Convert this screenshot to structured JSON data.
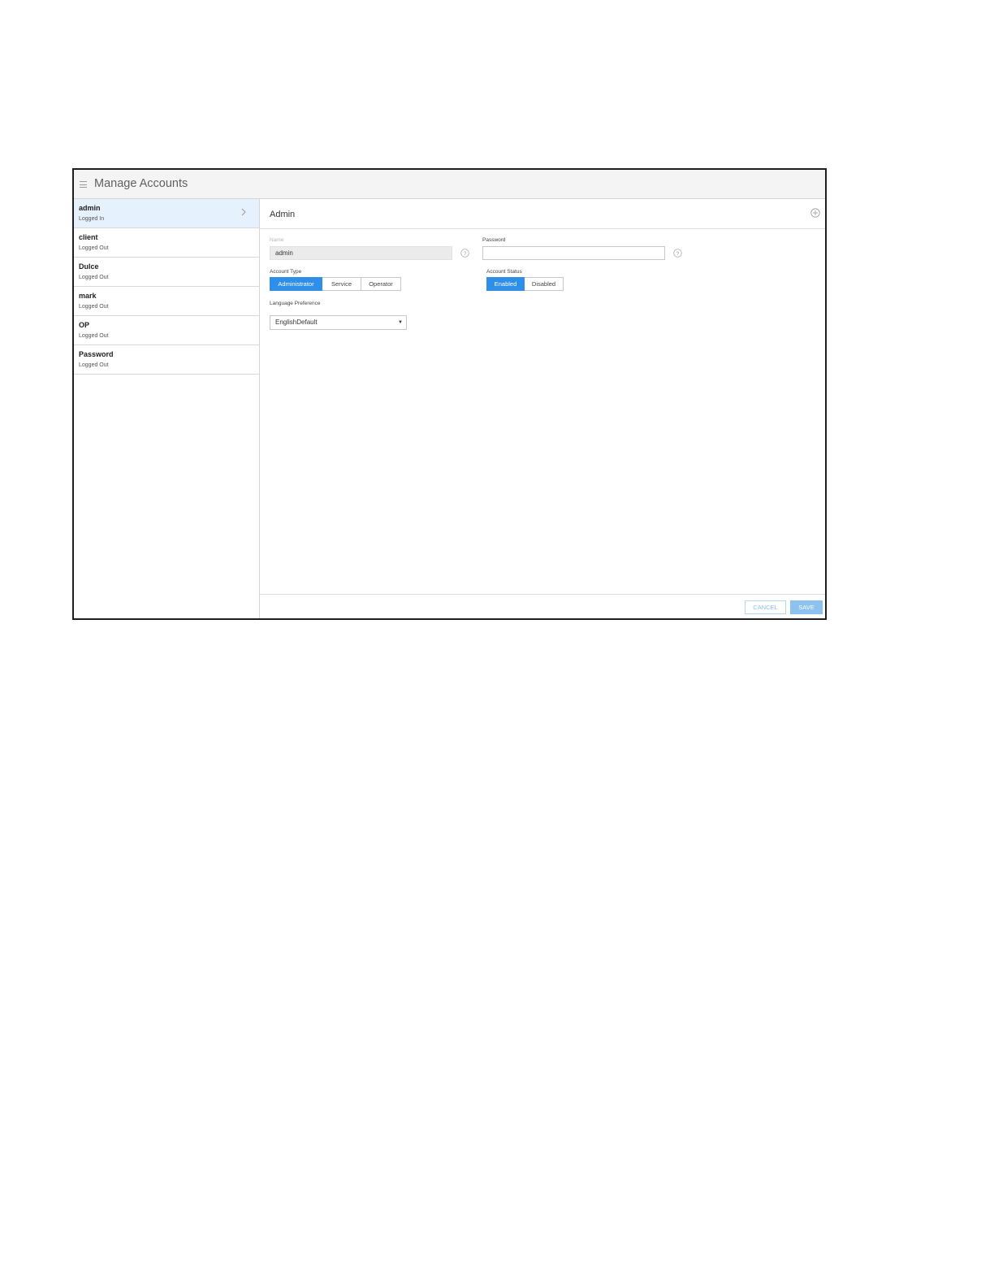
{
  "app": {
    "title": "Manage Accounts",
    "menu_icon": "hamburger-icon"
  },
  "accounts": [
    {
      "name": "admin",
      "status": "Logged In",
      "selected": true
    },
    {
      "name": "client",
      "status": "Logged Out"
    },
    {
      "name": "Dulce",
      "status": "Logged Out"
    },
    {
      "name": "mark",
      "status": "Logged Out"
    },
    {
      "name": "OP",
      "status": "Logged Out"
    },
    {
      "name": "Password",
      "status": "Logged Out"
    }
  ],
  "detail": {
    "title": "Admin",
    "add_icon": "plus-circle-icon",
    "name_label": "Name",
    "name_value": "admin",
    "password_label": "Password",
    "password_value": "",
    "account_type_label": "Account Type",
    "account_types": [
      "Administrator",
      "Service",
      "Operator"
    ],
    "account_type_selected": "Administrator",
    "account_status_label": "Account Status",
    "account_statuses": [
      "Enabled",
      "Disabled"
    ],
    "account_status_selected": "Enabled",
    "language_label": "Language Preference",
    "language_value": "EnglishDefault"
  },
  "footer": {
    "cancel_label": "CANCEL",
    "save_label": "SAVE"
  },
  "colors": {
    "accent": "#2f8ee8",
    "selected_row": "#e5f1fc",
    "save_button": "#8cc2f0"
  }
}
